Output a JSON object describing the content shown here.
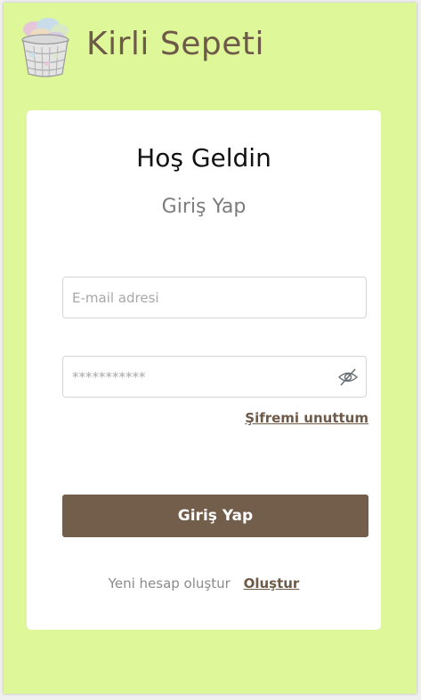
{
  "app": {
    "brand_name": "Kirli Sepeti"
  },
  "login": {
    "welcome_title": "Hoş Geldin",
    "subtitle": "Giriş Yap",
    "email_placeholder": "E-mail adresi",
    "email_value": "",
    "password_placeholder": "***********",
    "password_value": "",
    "forgot_password_label": "Şifremi unuttum",
    "submit_label": "Giriş Yap",
    "register_prompt": "Yeni hesap oluştur",
    "register_link_label": "Oluştur"
  },
  "icons": {
    "logo": "laundry-basket-icon",
    "password_toggle": "eye-slash-icon"
  },
  "colors": {
    "background": "#def799",
    "card": "#ffffff",
    "brand_text": "#6e5a49",
    "primary_button": "#735e4b",
    "muted_text": "#7c7c7c"
  }
}
